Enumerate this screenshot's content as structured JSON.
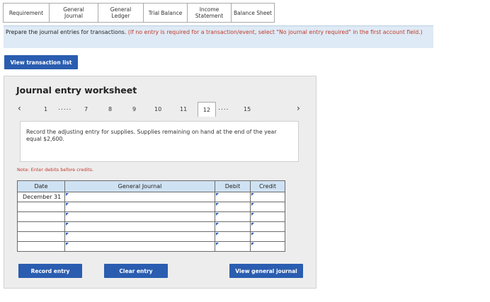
{
  "tabs": [
    {
      "label": "Requirement"
    },
    {
      "label": "General\nJournal"
    },
    {
      "label": "General\nLedger"
    },
    {
      "label": "Trial Balance"
    },
    {
      "label": "Income\nStatement"
    },
    {
      "label": "Balance Sheet"
    }
  ],
  "instructions": {
    "text": "Prepare the journal entries for transactions.",
    "note": "(If no entry is required for a transaction/event, select \"No journal entry required\" in the first account field.)"
  },
  "view_transaction_button": "View transaction list",
  "worksheet": {
    "title": "Journal entry worksheet",
    "pager": {
      "items": [
        "1",
        "7",
        "8",
        "9",
        "10",
        "11",
        "12",
        "15"
      ],
      "dots_left": ".....",
      "dots_right": "....",
      "current": "12"
    },
    "prompt": "Record the adjusting entry for supplies. Supplies remaining on hand at the end of the year equal $2,600.",
    "note": "Note: Enter debits before credits.",
    "table": {
      "headers": [
        "Date",
        "General Journal",
        "Debit",
        "Credit"
      ],
      "rows": [
        {
          "date": "December 31"
        },
        {
          "date": ""
        },
        {
          "date": ""
        },
        {
          "date": ""
        },
        {
          "date": ""
        },
        {
          "date": ""
        }
      ]
    },
    "buttons": {
      "record": "Record entry",
      "clear": "Clear entry",
      "view_journal": "View general journal"
    }
  },
  "colors": {
    "accent": "#2a5db0",
    "instruction_bg": "#deeaf5",
    "table_header_bg": "#cfe2f3",
    "note_red": "#c0392b"
  }
}
